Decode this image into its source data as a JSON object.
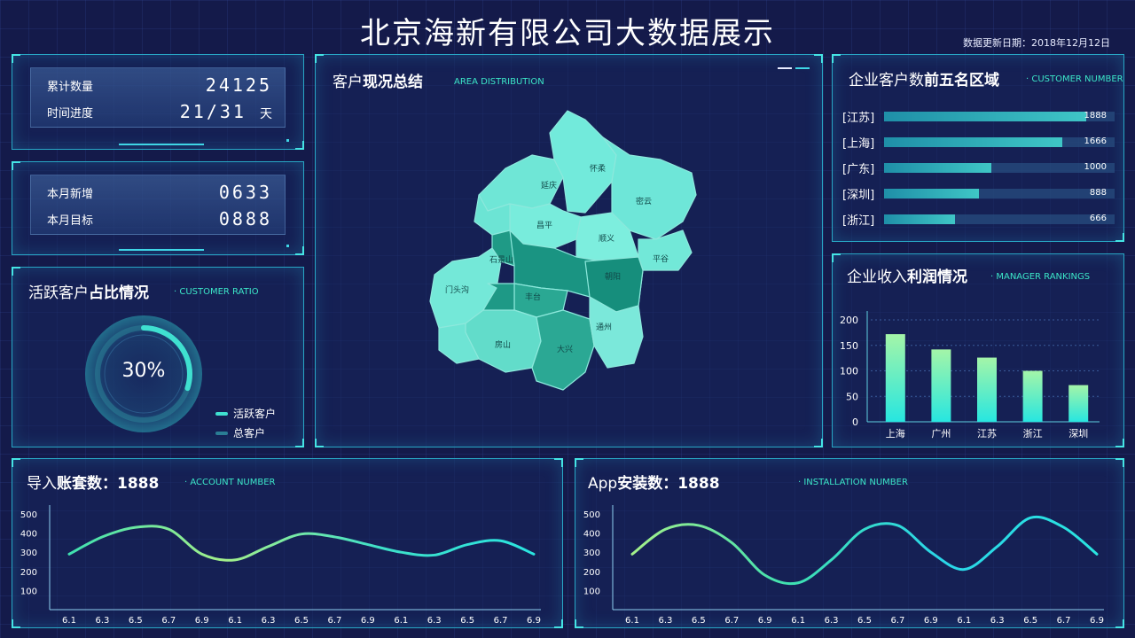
{
  "header": {
    "title": "北京海新有限公司大数据展示",
    "update": "数据更新日期：2018年12月12日"
  },
  "stats1": {
    "row1_label": "累计数量",
    "row1_value": "24125",
    "row2_label": "时间进度",
    "row2_value": "21/31",
    "row2_unit": "天"
  },
  "stats2": {
    "row1_label": "本月新增",
    "row1_value": "0633",
    "row2_label": "本月目标",
    "row2_value": "0888"
  },
  "active": {
    "title_a": "活跃客户",
    "title_b": "占比情况",
    "subtitle": "· CUSTOMER RATIO",
    "percent_label": "30%",
    "percent": 0.3,
    "legend": [
      "活跃客户",
      "总客户"
    ]
  },
  "map": {
    "title_a": "客户",
    "title_b": "现况总结",
    "subtitle": "AREA DISTRIBUTION",
    "districts": [
      "延庆",
      "怀柔",
      "密云",
      "昌平",
      "顺义",
      "平谷",
      "石景山",
      "门头沟",
      "朝阳",
      "丰台",
      "房山",
      "大兴",
      "通州"
    ]
  },
  "top5": {
    "title_a": "企业客户数",
    "title_b": "前五名区域",
    "subtitle": "· CUSTOMER NUMBER",
    "items": [
      {
        "label": "[江苏]",
        "value": "1888"
      },
      {
        "label": "[上海]",
        "value": "1666"
      },
      {
        "label": "[广东]",
        "value": "1000"
      },
      {
        "label": "[深圳]",
        "value": "888"
      },
      {
        "label": "[浙江]",
        "value": "666"
      }
    ]
  },
  "profit": {
    "title_a": "企业收入",
    "title_b": "利润情况",
    "subtitle": "· MANAGER RANKINGS"
  },
  "accounts": {
    "title_a": "导入",
    "title_b": "账套数：1888",
    "subtitle": "· ACCOUNT NUMBER"
  },
  "app": {
    "title_a": "App",
    "title_b": "安装数：1888",
    "subtitle": "· INSTALLATION NUMBER"
  },
  "colors": {
    "accent": "#3ce6c8",
    "border": "#28a6c4",
    "background": "#141a4a"
  },
  "chart_data": [
    {
      "type": "bar",
      "categories": [
        "上海",
        "广州",
        "江苏",
        "浙江",
        "深圳"
      ],
      "values": [
        172,
        142,
        126,
        100,
        72
      ],
      "ylim": [
        0,
        200
      ],
      "yticks": [
        0,
        50,
        100,
        150,
        200
      ]
    },
    {
      "type": "line",
      "x": [
        "6.1",
        "6.3",
        "6.5",
        "6.7",
        "6.9",
        "6.1",
        "6.3",
        "6.5",
        "6.7",
        "6.9",
        "6.1",
        "6.3",
        "6.5",
        "6.7",
        "6.9"
      ],
      "values": [
        290,
        380,
        430,
        420,
        290,
        260,
        330,
        395,
        380,
        340,
        300,
        285,
        340,
        360,
        290
      ],
      "ylim": [
        0,
        500
      ],
      "yticks": [
        100,
        200,
        300,
        400,
        500
      ]
    },
    {
      "type": "line",
      "x": [
        "6.1",
        "6.3",
        "6.5",
        "6.7",
        "6.9",
        "6.1",
        "6.3",
        "6.5",
        "6.7",
        "6.9",
        "6.1",
        "6.3",
        "6.5",
        "6.7",
        "6.9"
      ],
      "values": [
        290,
        420,
        440,
        350,
        180,
        140,
        260,
        420,
        440,
        300,
        210,
        330,
        480,
        430,
        290
      ],
      "ylim": [
        0,
        500
      ],
      "yticks": [
        100,
        200,
        300,
        400,
        500
      ]
    }
  ]
}
